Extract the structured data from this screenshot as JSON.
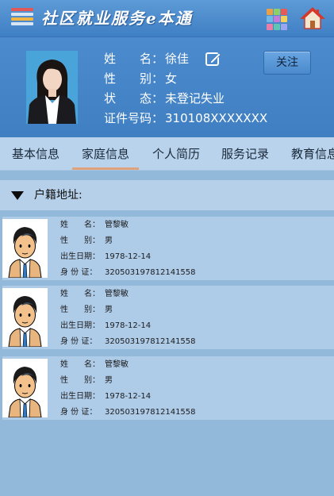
{
  "header": {
    "title": "社区就业服务e本通"
  },
  "profile": {
    "name_label": "姓　　名：",
    "name": "徐佳",
    "gender_label": "性　　别：",
    "gender": "女",
    "status_label": "状　　态：",
    "status": "未登记失业",
    "id_label": "证件号码：",
    "id_number": "310108XXXXXXX",
    "follow_label": "关注"
  },
  "tabs": [
    {
      "label": "基本信息"
    },
    {
      "label": "家庭信息"
    },
    {
      "label": "个人简历"
    },
    {
      "label": "服务记录"
    },
    {
      "label": "教育信息"
    }
  ],
  "active_tab": "家庭信息",
  "section": {
    "title": "户籍地址:"
  },
  "members": [
    {
      "name_label": "姓　　名：",
      "name": "管黎敏",
      "gender_label": "性　　别：",
      "gender": "男",
      "birth_label": "出生日期：",
      "birth": "1978-12-14",
      "id_label": "身 份 证：",
      "id": "320503197812141558"
    },
    {
      "name_label": "姓　　名：",
      "name": "管黎敏",
      "gender_label": "性　　别：",
      "gender": "男",
      "birth_label": "出生日期：",
      "birth": "1978-12-14",
      "id_label": "身 份 证：",
      "id": "320503197812141558"
    },
    {
      "name_label": "姓　　名：",
      "name": "管黎敏",
      "gender_label": "性　　别：",
      "gender": "男",
      "birth_label": "出生日期：",
      "birth": "1978-12-14",
      "id_label": "身 份 证：",
      "id": "320503197812141558"
    }
  ],
  "icons": {
    "menu": "menu-icon",
    "grid": "apps-grid-icon",
    "home": "home-icon",
    "edit": "edit-icon",
    "collapse": "collapse-triangle-icon",
    "avatar": "user-avatar-icon"
  },
  "colors": {
    "header_bg": "#4a8ad0",
    "tab_bg": "#b9d3ec",
    "active_tab_underline": "#e0a27a",
    "card_bg": "#aecbe8",
    "page_bg": "#92b8da"
  }
}
